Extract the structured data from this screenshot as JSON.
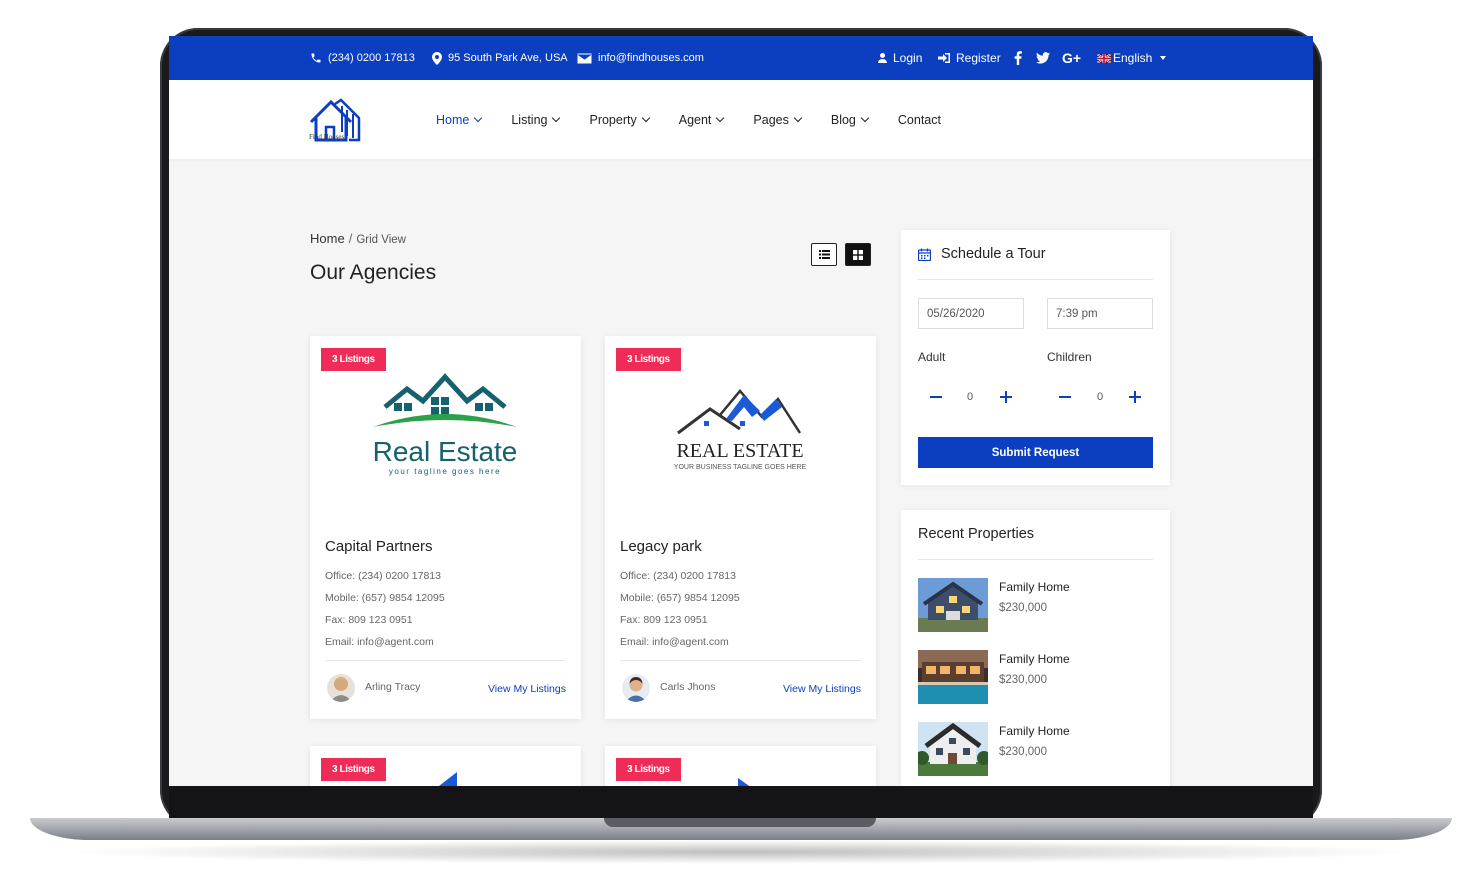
{
  "topbar": {
    "phone": "(234) 0200 17813",
    "address": "95 South Park Ave, USA",
    "email": "info@findhouses.com",
    "login": "Login",
    "register": "Register",
    "language": "English"
  },
  "header": {
    "logo_text": "Find Houses",
    "nav": [
      {
        "label": "Home",
        "active": true
      },
      {
        "label": "Listing"
      },
      {
        "label": "Property"
      },
      {
        "label": "Agent"
      },
      {
        "label": "Pages"
      },
      {
        "label": "Blog"
      },
      {
        "label": "Contact"
      }
    ]
  },
  "main": {
    "breadcrumb": {
      "home": "Home",
      "separator": "/",
      "current": "Grid View"
    },
    "title": "Our Agencies",
    "agencies": [
      {
        "badge": "3 Listings",
        "logo_title": "Real Estate",
        "logo_tagline": "your tagline goes here",
        "name": "Capital Partners",
        "office": "Office: (234) 0200 17813",
        "mobile": "Mobile: (657) 9854 12095",
        "fax": "Fax: 809 123 0951",
        "email": "Email: info@agent.com",
        "agent": "Arling Tracy",
        "link": "View My Listings"
      },
      {
        "badge": "3 Listings",
        "logo_title": "REAL ESTATE",
        "logo_tagline": "YOUR BUSINESS TAGLINE GOES HERE",
        "name": "Legacy park",
        "office": "Office: (234) 0200 17813",
        "mobile": "Mobile: (657) 9854 12095",
        "fax": "Fax: 809 123 0951",
        "email": "Email: info@agent.com",
        "agent": "Carls Jhons",
        "link": "View My Listings"
      },
      {
        "badge": "3 Listings"
      },
      {
        "badge": "3 Listings"
      }
    ]
  },
  "sidebar": {
    "tour": {
      "title": "Schedule a Tour",
      "date": "05/26/2020",
      "time": "7:39 pm",
      "adult_label": "Adult",
      "adult_value": "0",
      "children_label": "Children",
      "children_value": "0",
      "submit": "Submit Request"
    },
    "recent": {
      "title": "Recent Properties",
      "items": [
        {
          "title": "Family Home",
          "price": "$230,000"
        },
        {
          "title": "Family Home",
          "price": "$230,000"
        },
        {
          "title": "Family Home",
          "price": "$230,000"
        }
      ]
    }
  },
  "colors": {
    "primary": "#0b3fbf",
    "badge": "#ef2b57",
    "topbar": "#0b3fbf"
  }
}
